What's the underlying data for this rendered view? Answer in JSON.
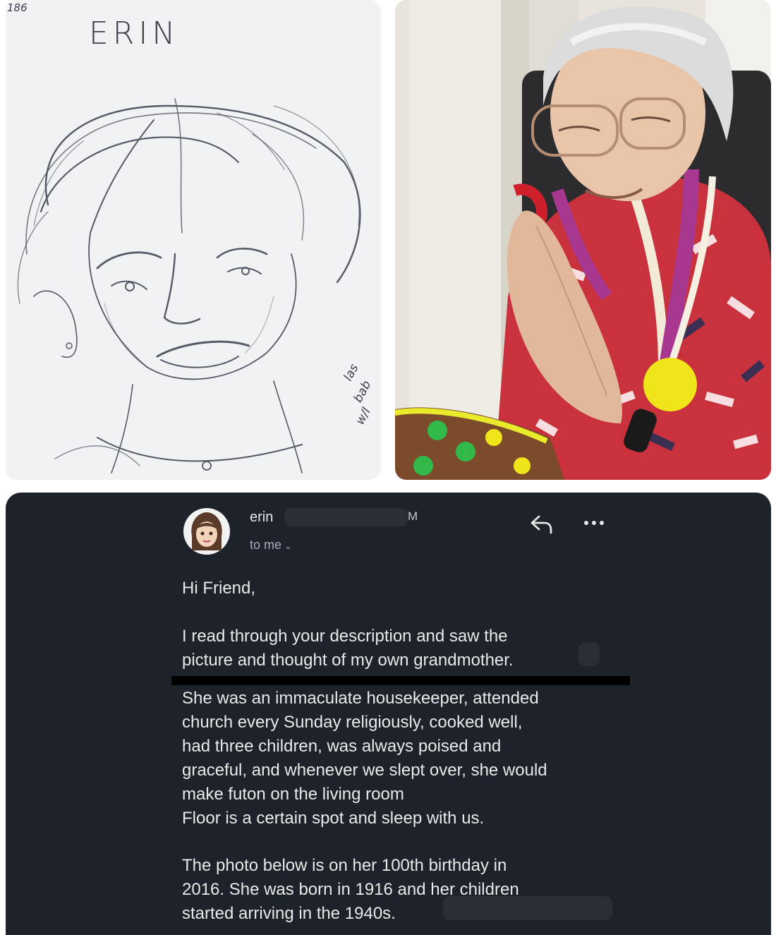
{
  "sketch": {
    "corner_number": "186",
    "title": "ERIN",
    "margin_note": [
      "las",
      "bab",
      "w/l"
    ]
  },
  "email": {
    "sender": "erin",
    "sender_suffix": "M",
    "recipient": "to me",
    "icons": [
      "reply-icon",
      "more-icon",
      "chevron-down-icon"
    ],
    "lines": [
      "Hi Friend,",
      "I read through your description and saw the",
      "picture and thought of my own grandmother.",
      "She was an immaculate housekeeper, attended",
      "church every Sunday religiously, cooked well,",
      "had three children, was always poised and",
      "graceful, and whenever we slept over, she would",
      "make futon on the living room",
      "Floor is a certain spot and sleep with us.",
      "The photo below is on her 100th birthday in",
      "2016.  She was born in 1916 and her children",
      "started arriving in the 1940s."
    ]
  },
  "colors": {
    "email_bg": "#1e222a",
    "email_text": "#e9e9e9",
    "muted_text": "#a8adb7",
    "divider": "#000000"
  }
}
